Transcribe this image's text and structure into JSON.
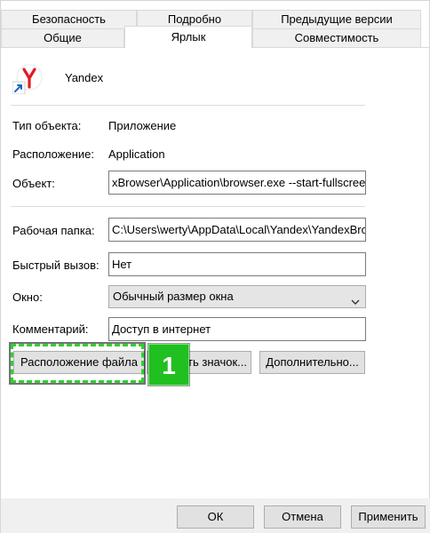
{
  "tabs_row1": [
    "Безопасность",
    "Подробно",
    "Предыдущие версии"
  ],
  "tabs_row2": [
    "Общие",
    "Ярлык",
    "Совместимость"
  ],
  "app": {
    "name": "Yandex",
    "icon": "yandex-browser-icon"
  },
  "fields": {
    "object_type_label": "Тип объекта:",
    "object_type_value": "Приложение",
    "location_label": "Расположение:",
    "location_value": "Application",
    "target_label": "Объект:",
    "target_value": "xBrowser\\Application\\browser.exe --start-fullscreen",
    "start_in_label": "Рабочая папка:",
    "start_in_value": "C:\\Users\\werty\\AppData\\Local\\Yandex\\YandexBrow",
    "shortcut_key_label": "Быстрый вызов:",
    "shortcut_key_value": "Нет",
    "run_label": "Окно:",
    "run_value": "Обычный размер окна",
    "comment_label": "Комментарий:",
    "comment_value": "Доступ в интернет"
  },
  "buttons": {
    "open_location": "Расположение файла",
    "change_icon": "Сменить значок...",
    "advanced": "Дополнительно..."
  },
  "annotation": {
    "badge": "1",
    "color": "#20c020"
  },
  "footer": {
    "ok": "ОК",
    "cancel": "Отмена",
    "apply": "Применить"
  }
}
